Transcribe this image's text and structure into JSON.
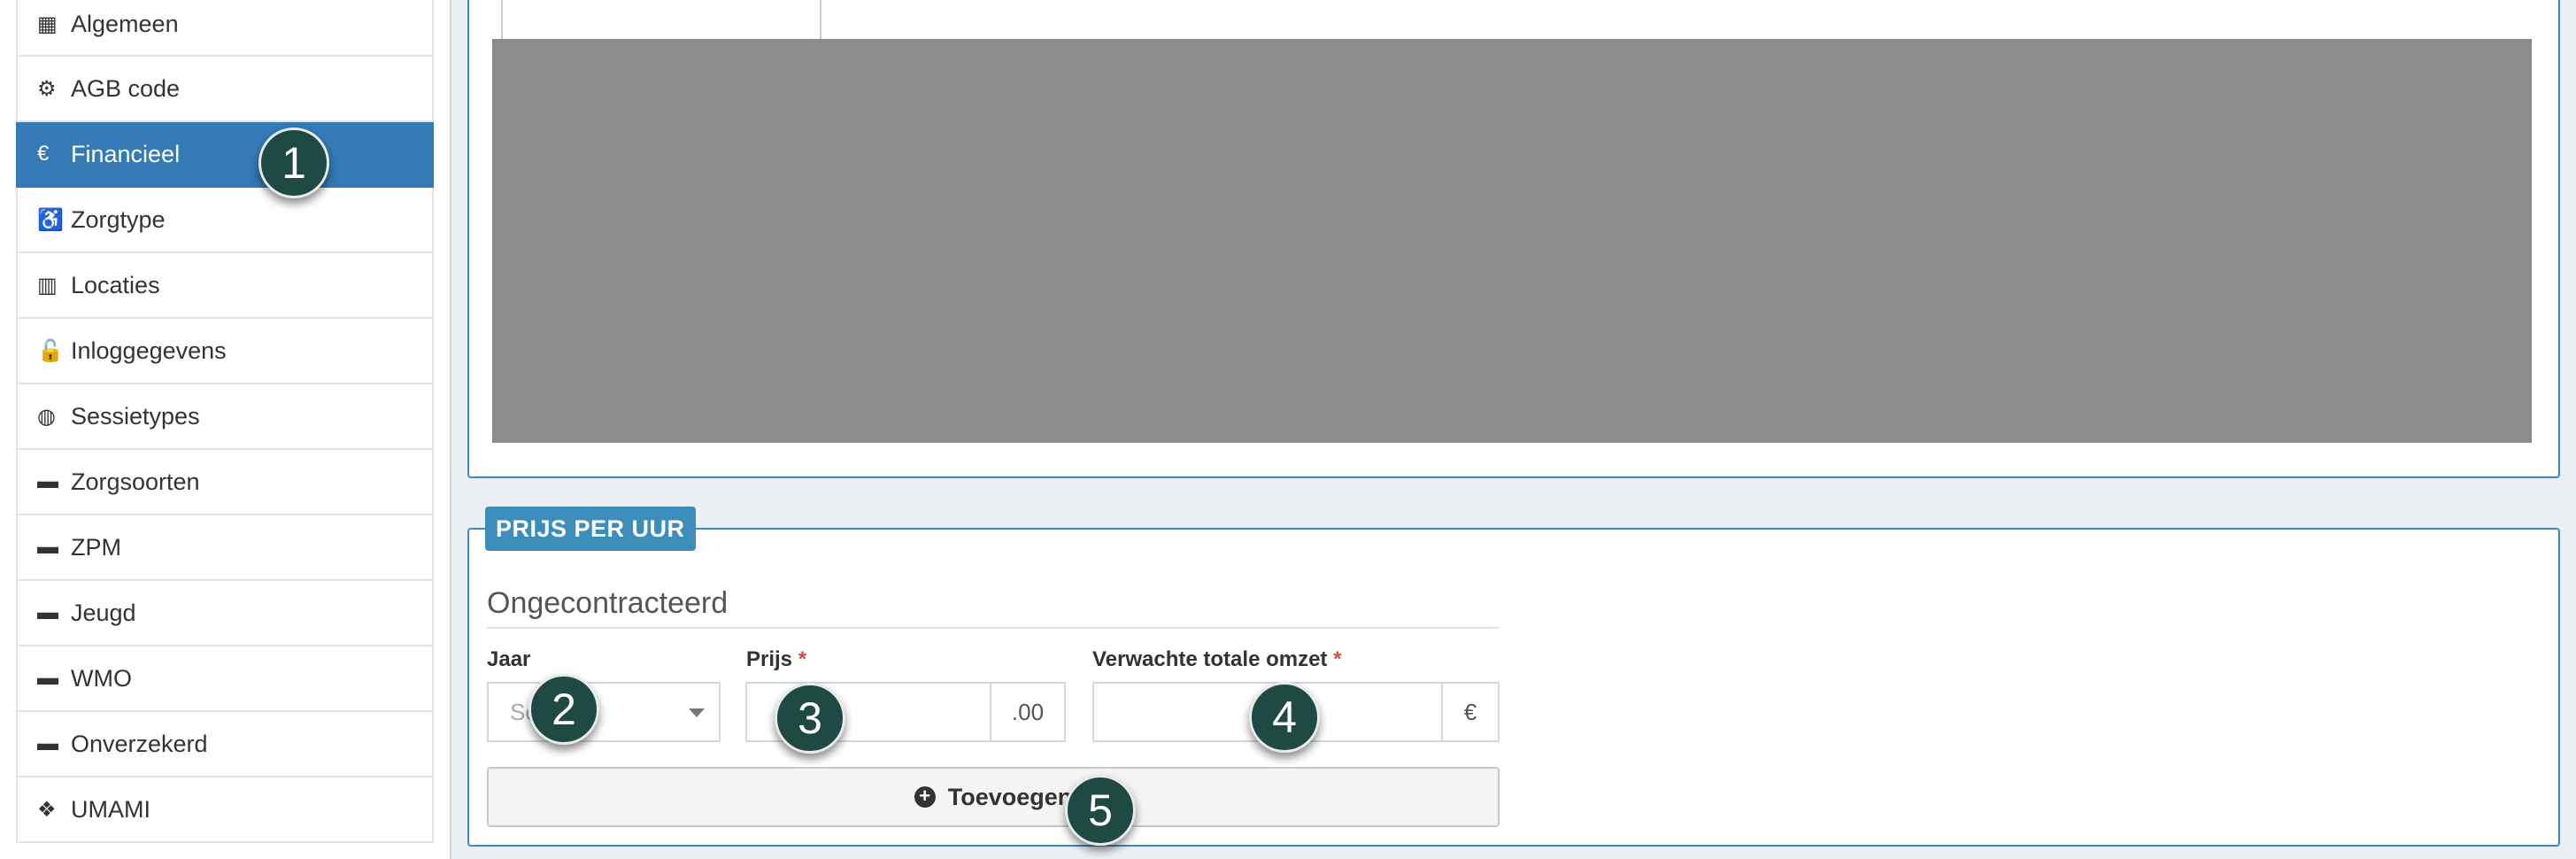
{
  "sidebar": {
    "items": [
      {
        "label": "Algemeen",
        "icon": "table-icon",
        "glyph": "▦",
        "active": false
      },
      {
        "label": "AGB code",
        "icon": "cogs-icon",
        "glyph": "⚙",
        "active": false
      },
      {
        "label": "Financieel",
        "icon": "euro-icon",
        "glyph": "€",
        "active": true
      },
      {
        "label": "Zorgtype",
        "icon": "accessibility-icon",
        "glyph": "♿",
        "active": false
      },
      {
        "label": "Locaties",
        "icon": "map-icon",
        "glyph": "▥",
        "active": false
      },
      {
        "label": "Inloggegevens",
        "icon": "unlock-icon",
        "glyph": "🔓",
        "active": false
      },
      {
        "label": "Sessietypes",
        "icon": "globe-icon",
        "glyph": "◍",
        "active": false
      },
      {
        "label": "Zorgsoorten",
        "icon": "briefcase-icon",
        "glyph": "▬",
        "active": false
      },
      {
        "label": "ZPM",
        "icon": "briefcase-icon",
        "glyph": "▬",
        "active": false
      },
      {
        "label": "Jeugd",
        "icon": "briefcase-icon",
        "glyph": "▬",
        "active": false
      },
      {
        "label": "WMO",
        "icon": "briefcase-icon",
        "glyph": "▬",
        "active": false
      },
      {
        "label": "Onverzekerd",
        "icon": "briefcase-icon",
        "glyph": "▬",
        "active": false
      },
      {
        "label": "UMAMI",
        "icon": "cubes-icon",
        "glyph": "❖",
        "active": false
      }
    ]
  },
  "price_panel": {
    "badge": "PRIJS PER UUR",
    "section_title": "Ongecontracteerd",
    "jaar_label": "Jaar",
    "jaar_placeholder": "Se",
    "prijs_label": "Prijs",
    "prijs_required": "*",
    "prijs_addon": ".00",
    "omzet_label": "Verwachte totale omzet",
    "omzet_required": "*",
    "omzet_addon": "€",
    "add_button": "Toevoegen"
  },
  "markers": [
    "1",
    "2",
    "3",
    "4",
    "5"
  ],
  "colors": {
    "accent": "#3c8dbc",
    "active_item": "#337ab7",
    "marker": "#1f4a43",
    "required": "#dd4b39",
    "placeholder_block": "#8c8c8c"
  }
}
